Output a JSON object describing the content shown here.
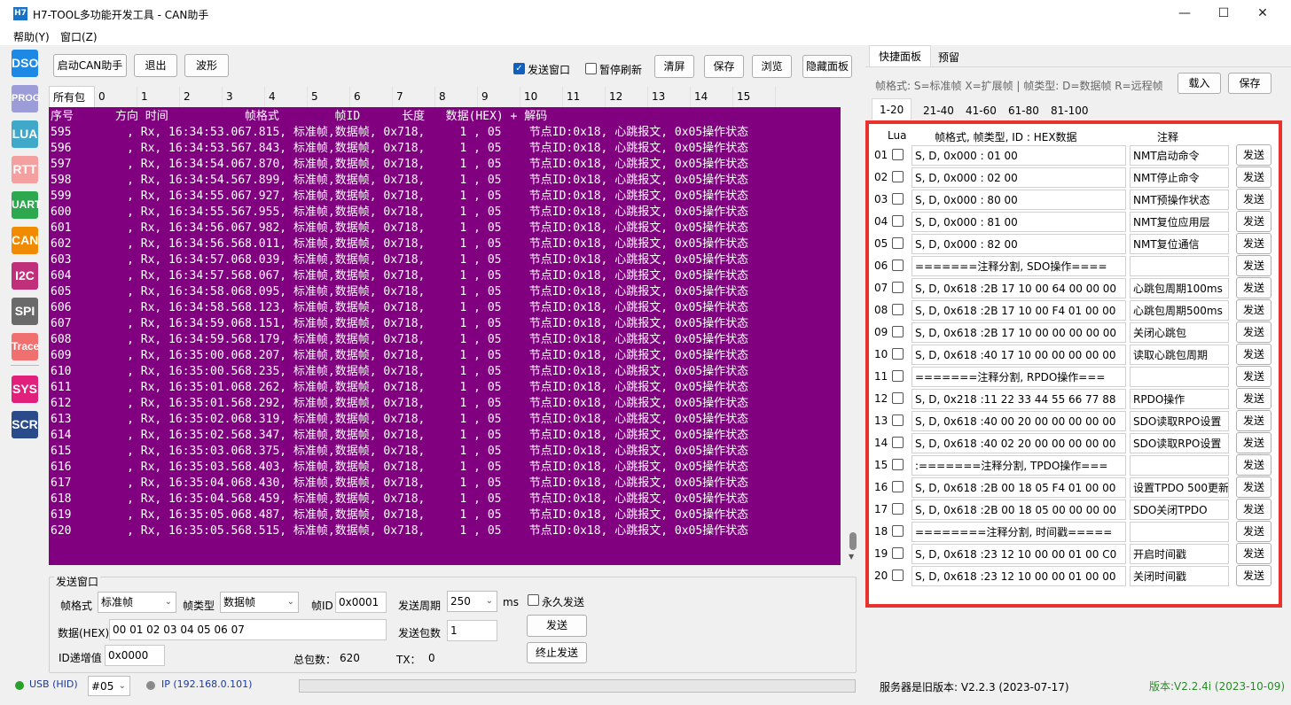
{
  "window": {
    "title": "H7-TOOL多功能开发工具 - CAN助手",
    "icon_text": "H7",
    "minimize": "—",
    "maximize": "☐",
    "close": "✕"
  },
  "menu": [
    "帮助(Y)",
    "窗口(Z)"
  ],
  "sidebar": [
    "DSO",
    "PROG",
    "LUA",
    "RTT",
    "UART",
    "CAN",
    "I2C",
    "SPI",
    "Trace",
    "SYS",
    "SCR"
  ],
  "toolbar": {
    "start": "启动CAN助手",
    "exit": "退出",
    "wave": "波形",
    "send_window": "发送窗口",
    "pause_refresh": "暂停刷新",
    "clear": "清屏",
    "save": "保存",
    "browse": "浏览",
    "hide_panel": "隐藏面板"
  },
  "packet_tabs": [
    "所有包",
    "0",
    "1",
    "2",
    "3",
    "4",
    "5",
    "6",
    "7",
    "8",
    "9",
    "10",
    "11",
    "12",
    "13",
    "14",
    "15"
  ],
  "log": {
    "header": "序号      方向 时间           帧格式        帧ID      长度   数据(HEX) + 解码",
    "lines": [
      "595        , Rx, 16:34:53.067.815, 标准帧,数据帧, 0x718,     1 , 05    节点ID:0x18, 心跳报文, 0x05操作状态",
      "596        , Rx, 16:34:53.567.843, 标准帧,数据帧, 0x718,     1 , 05    节点ID:0x18, 心跳报文, 0x05操作状态",
      "597        , Rx, 16:34:54.067.870, 标准帧,数据帧, 0x718,     1 , 05    节点ID:0x18, 心跳报文, 0x05操作状态",
      "598        , Rx, 16:34:54.567.899, 标准帧,数据帧, 0x718,     1 , 05    节点ID:0x18, 心跳报文, 0x05操作状态",
      "599        , Rx, 16:34:55.067.927, 标准帧,数据帧, 0x718,     1 , 05    节点ID:0x18, 心跳报文, 0x05操作状态",
      "600        , Rx, 16:34:55.567.955, 标准帧,数据帧, 0x718,     1 , 05    节点ID:0x18, 心跳报文, 0x05操作状态",
      "601        , Rx, 16:34:56.067.982, 标准帧,数据帧, 0x718,     1 , 05    节点ID:0x18, 心跳报文, 0x05操作状态",
      "602        , Rx, 16:34:56.568.011, 标准帧,数据帧, 0x718,     1 , 05    节点ID:0x18, 心跳报文, 0x05操作状态",
      "603        , Rx, 16:34:57.068.039, 标准帧,数据帧, 0x718,     1 , 05    节点ID:0x18, 心跳报文, 0x05操作状态",
      "604        , Rx, 16:34:57.568.067, 标准帧,数据帧, 0x718,     1 , 05    节点ID:0x18, 心跳报文, 0x05操作状态",
      "605        , Rx, 16:34:58.068.095, 标准帧,数据帧, 0x718,     1 , 05    节点ID:0x18, 心跳报文, 0x05操作状态",
      "606        , Rx, 16:34:58.568.123, 标准帧,数据帧, 0x718,     1 , 05    节点ID:0x18, 心跳报文, 0x05操作状态",
      "607        , Rx, 16:34:59.068.151, 标准帧,数据帧, 0x718,     1 , 05    节点ID:0x18, 心跳报文, 0x05操作状态",
      "608        , Rx, 16:34:59.568.179, 标准帧,数据帧, 0x718,     1 , 05    节点ID:0x18, 心跳报文, 0x05操作状态",
      "609        , Rx, 16:35:00.068.207, 标准帧,数据帧, 0x718,     1 , 05    节点ID:0x18, 心跳报文, 0x05操作状态",
      "610        , Rx, 16:35:00.568.235, 标准帧,数据帧, 0x718,     1 , 05    节点ID:0x18, 心跳报文, 0x05操作状态",
      "611        , Rx, 16:35:01.068.262, 标准帧,数据帧, 0x718,     1 , 05    节点ID:0x18, 心跳报文, 0x05操作状态",
      "612        , Rx, 16:35:01.568.292, 标准帧,数据帧, 0x718,     1 , 05    节点ID:0x18, 心跳报文, 0x05操作状态",
      "613        , Rx, 16:35:02.068.319, 标准帧,数据帧, 0x718,     1 , 05    节点ID:0x18, 心跳报文, 0x05操作状态",
      "614        , Rx, 16:35:02.568.347, 标准帧,数据帧, 0x718,     1 , 05    节点ID:0x18, 心跳报文, 0x05操作状态",
      "615        , Rx, 16:35:03.068.375, 标准帧,数据帧, 0x718,     1 , 05    节点ID:0x18, 心跳报文, 0x05操作状态",
      "616        , Rx, 16:35:03.568.403, 标准帧,数据帧, 0x718,     1 , 05    节点ID:0x18, 心跳报文, 0x05操作状态",
      "617        , Rx, 16:35:04.068.430, 标准帧,数据帧, 0x718,     1 , 05    节点ID:0x18, 心跳报文, 0x05操作状态",
      "618        , Rx, 16:35:04.568.459, 标准帧,数据帧, 0x718,     1 , 05    节点ID:0x18, 心跳报文, 0x05操作状态",
      "619        , Rx, 16:35:05.068.487, 标准帧,数据帧, 0x718,     1 , 05    节点ID:0x18, 心跳报文, 0x05操作状态",
      "620        , Rx, 16:35:05.568.515, 标准帧,数据帧, 0x718,     1 , 05    节点ID:0x18, 心跳报文, 0x05操作状态"
    ]
  },
  "send": {
    "group_title": "发送窗口",
    "frame_format_label": "帧格式",
    "frame_format": "标准帧",
    "frame_type_label": "帧类型",
    "frame_type": "数据帧",
    "frame_id_label": "帧ID",
    "frame_id": "0x0001",
    "period_label": "发送周期",
    "period": "250",
    "period_unit": "ms",
    "forever_label": "永久发送",
    "data_label": "数据(HEX)",
    "data": "00 01 02 03 04 05 06 07",
    "count_label": "发送包数",
    "count": "1",
    "send_btn": "发送",
    "stop_btn": "终止发送",
    "id_inc_label": "ID递增值",
    "id_inc": "0x0000",
    "total_label": "总包数：",
    "total": "620",
    "tx_label": "TX：",
    "tx": "0"
  },
  "status": {
    "usb": "USB (HID)",
    "port": "#05",
    "ip": "IP (192.168.0.101)",
    "server": "服务器是旧版本: V2.2.3 (2023-07-17)",
    "version": "版本:V2.2.4i (2023-10-09)"
  },
  "panel": {
    "tabs": [
      "快捷面板",
      "预留"
    ],
    "legend": "帧格式: S=标准帧 X=扩展帧 | 帧类型: D=数据帧 R=远程帧",
    "load": "载入",
    "save": "保存",
    "range_tabs": [
      "1-20",
      "21-40",
      "41-60",
      "61-80",
      "81-100"
    ],
    "col_lua": "Lua",
    "col_data": "帧格式, 帧类型, ID : HEX数据",
    "col_note": "注释",
    "send_label": "发送",
    "rows": [
      {
        "n": "01",
        "data": "S, D, 0x000 : 01 00",
        "note": "NMT启动命令"
      },
      {
        "n": "02",
        "data": "S, D, 0x000 : 02 00",
        "note": "NMT停止命令"
      },
      {
        "n": "03",
        "data": "S, D, 0x000 : 80 00",
        "note": "NMT预操作状态"
      },
      {
        "n": "04",
        "data": "S, D, 0x000 : 81 00",
        "note": "NMT复位应用层"
      },
      {
        "n": "05",
        "data": "S, D, 0x000 : 82 00",
        "note": "NMT复位通信"
      },
      {
        "n": "06",
        "data": "=======注释分割, SDO操作====",
        "note": ""
      },
      {
        "n": "07",
        "data": "S, D, 0x618 :2B 17 10 00 64 00 00 00",
        "note": "心跳包周期100ms"
      },
      {
        "n": "08",
        "data": "S, D, 0x618 :2B 17 10 00 F4 01 00 00",
        "note": "心跳包周期500ms"
      },
      {
        "n": "09",
        "data": "S, D, 0x618 :2B 17 10 00 00 00 00 00",
        "note": "关闭心跳包"
      },
      {
        "n": "10",
        "data": "S, D, 0x618 :40 17 10 00 00 00 00 00",
        "note": "读取心跳包周期"
      },
      {
        "n": "11",
        "data": "=======注释分割, RPDO操作===",
        "note": ""
      },
      {
        "n": "12",
        "data": "S, D, 0x218 :11 22 33 44 55 66 77 88",
        "note": "RPDO操作"
      },
      {
        "n": "13",
        "data": "S, D, 0x618 :40 00 20 00 00 00 00 00",
        "note": "SDO读取RPO设置"
      },
      {
        "n": "14",
        "data": "S, D, 0x618 :40 02 20 00 00 00 00 00",
        "note": "SDO读取RPO设置"
      },
      {
        "n": "15",
        "data": ":=======注释分割, TPDO操作===",
        "note": ""
      },
      {
        "n": "16",
        "data": "S, D, 0x618 :2B 00 18 05 F4 01 00 00",
        "note": "设置TPDO 500更新"
      },
      {
        "n": "17",
        "data": "S, D, 0x618 :2B 00 18 05 00 00 00 00",
        "note": "SDO关闭TPDO"
      },
      {
        "n": "18",
        "data": "========注释分割, 时间戳=====",
        "note": ""
      },
      {
        "n": "19",
        "data": "S, D, 0x618 :23 12 10 00 00 01 00 C0",
        "note": "开启时间戳"
      },
      {
        "n": "20",
        "data": "S, D, 0x618 :23 12 10 00 00 01 00 00",
        "note": "关闭时间戳"
      }
    ]
  }
}
